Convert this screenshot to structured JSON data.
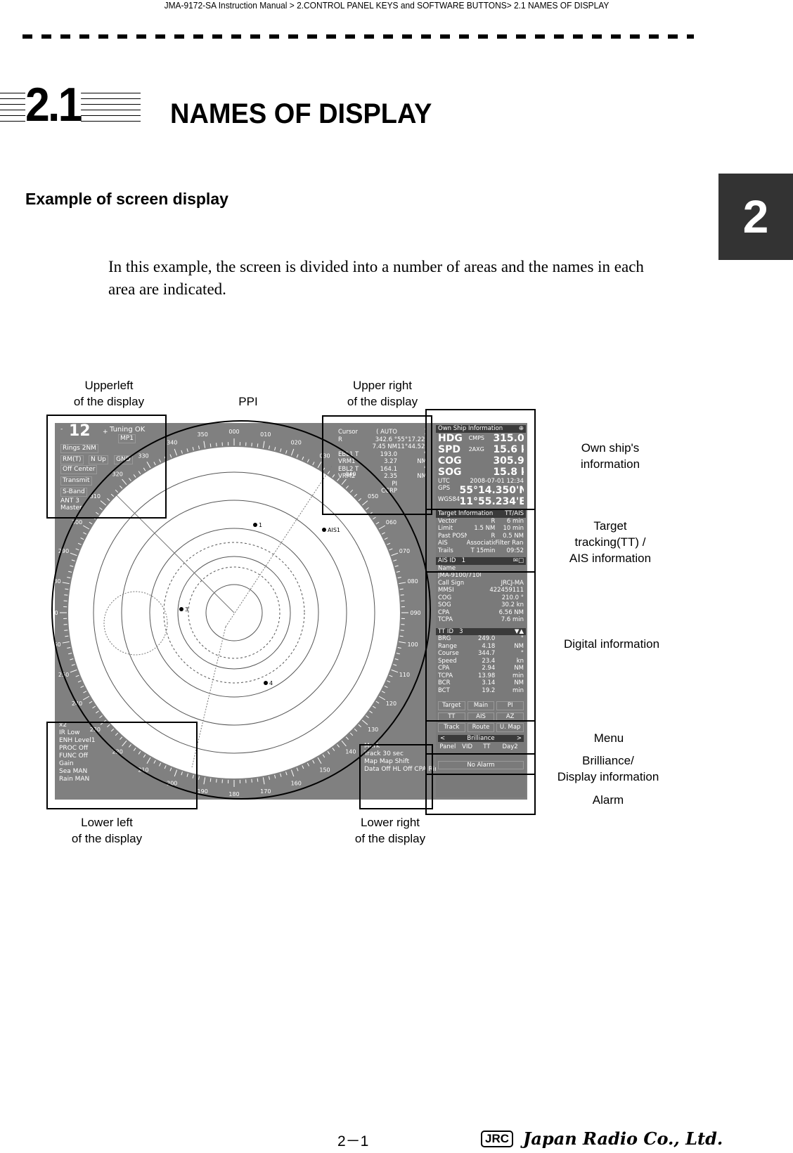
{
  "header": {
    "breadcrumb": "JMA-9172-SA Instruction Manual > 2.CONTROL PANEL KEYS and SOFTWARE BUTTONS> 2.1  NAMES OF DISPLAY"
  },
  "section": {
    "number": "2.1",
    "title": "NAMES OF DISPLAY",
    "chapter_tab": "2"
  },
  "subtitle": "Example of screen display",
  "paragraph": "In this example, the screen is divided into a number of areas and the names in each area are indicated.",
  "labels": {
    "upper_left": [
      "Upperleft",
      "of the display"
    ],
    "ppi": "PPI",
    "upper_right": [
      "Upper right",
      "of the display"
    ],
    "own_ship": [
      "Own ship's",
      "information"
    ],
    "target": [
      "Target",
      "tracking(TT) /",
      "AIS information"
    ],
    "digital": "Digital information",
    "menu": "Menu",
    "brilliance": [
      "Brilliance/",
      "Display  information"
    ],
    "alarm": "Alarm",
    "lower_left": [
      "Lower left",
      "of the display"
    ],
    "lower_right": [
      "Lower right",
      "of the display"
    ]
  },
  "radar": {
    "bearings": [
      "000",
      "010",
      "020",
      "030",
      "040",
      "050",
      "060",
      "070",
      "080",
      "090",
      "100",
      "110",
      "120",
      "130",
      "140",
      "150",
      "160",
      "170",
      "180",
      "190",
      "200",
      "210",
      "220",
      "230",
      "240",
      "250",
      "260",
      "270",
      "280",
      "290",
      "300",
      "310",
      "320",
      "330",
      "340",
      "350"
    ],
    "targets": [
      "1",
      "3",
      "4",
      "AIS1"
    ],
    "upper_left": {
      "minus": "-",
      "range": "12",
      "plus": "+",
      "tuning": "Tuning OK",
      "pulse": "MP1",
      "rings": "Rings  2NM",
      "motion": "RM(T)",
      "orient": "N  Up",
      "stab": "GND",
      "center": "Off  Center",
      "tx": "Transmit",
      "band": "S-Band",
      "ant": "ANT  3",
      "master": "Master"
    },
    "upper_right": {
      "rows": [
        [
          "Cursor",
          "(  AUTO",
          ")"
        ],
        [
          "R",
          "342.6 °",
          "55°17.229'N"
        ],
        [
          "",
          "7.45 NM",
          "11°44.529'E"
        ],
        [
          "EBL1 T",
          "193.0",
          "°"
        ],
        [
          "VRM1",
          "3.27",
          "NM"
        ],
        [
          "EBL2 T",
          "164.1",
          "°"
        ],
        [
          "VRM2",
          "2.35",
          "NM"
        ],
        [
          "",
          "PI",
          ""
        ],
        [
          "",
          "CCRP",
          ""
        ]
      ]
    },
    "own_ship": {
      "title": "Own  Ship  Information",
      "rows": [
        [
          "HDG",
          "CMPS",
          "315.0 °"
        ],
        [
          "SPD",
          "2AXG",
          "15.6 kn"
        ],
        [
          "COG",
          "",
          "305.9 °"
        ],
        [
          "SOG",
          "",
          "15.8 kn"
        ]
      ],
      "utc_label": "UTC",
      "utc": "2008-07-01  12:34",
      "gps": "GPS",
      "lat": "55°14.350'N",
      "datum": "WGS84",
      "lon": "11°55.234'E"
    },
    "target_info": {
      "title": "Target  Information",
      "mode": "TT/AIS",
      "rows": [
        [
          "Vector",
          "R",
          "6 min"
        ],
        [
          "Limit",
          "1.5 NM",
          "10 min"
        ],
        [
          "Past  POSN",
          "R",
          "0.5  NM"
        ],
        [
          "AIS",
          "Association",
          "Filter  Range"
        ],
        [
          "Trails",
          "T  15min",
          "09:52"
        ]
      ]
    },
    "ais": {
      "title": "AIS  ID",
      "id": "1",
      "rows": [
        [
          "Name",
          ""
        ],
        [
          "JMA-9100/7100  SERIES",
          ""
        ],
        [
          "Call  Sign",
          "JRCJ-MA"
        ],
        [
          "MMSI",
          "422459111"
        ],
        [
          "COG",
          "210.0 °"
        ],
        [
          "SOG",
          "30.2  kn"
        ],
        [
          "CPA",
          "6.56 NM"
        ],
        [
          "TCPA",
          "7.6  min"
        ]
      ]
    },
    "tt": {
      "title": "TT  ID",
      "id": "3",
      "rows": [
        [
          "BRG",
          "249.0",
          "°"
        ],
        [
          "Range",
          "4.18",
          "NM"
        ],
        [
          "Course",
          "344.7",
          "°"
        ],
        [
          "Speed",
          "23.4",
          "kn"
        ],
        [
          "CPA",
          "2.94",
          "NM"
        ],
        [
          "TCPA",
          "13.98",
          "min"
        ],
        [
          "BCR",
          "3.14",
          "NM"
        ],
        [
          "BCT",
          "19.2",
          "min"
        ]
      ]
    },
    "menu": [
      "Target",
      "Main",
      "PI",
      "TT",
      "AIS",
      "AZ",
      "Track",
      "Route",
      "U. Map"
    ],
    "brilliance": {
      "title": "Brilliance",
      "prev": "<",
      "next": ">",
      "items": [
        "Panel",
        "VID",
        "TT",
        "Day2"
      ]
    },
    "alarm": "No  Alarm",
    "lower_left": [
      "x2",
      "IR  Low",
      "ENH  Level1",
      "PROC  Off",
      "FUNC  Off",
      "Gain",
      "Sea   MAN",
      "Rain  MAN"
    ],
    "lower_right": [
      "Mark",
      "Track   30  sec",
      "Map  Map  Shift",
      "Data Off   HL Off   CPA Ring"
    ]
  },
  "footer": {
    "page": "2－1",
    "logo_mark": "JRC",
    "company": "Japan Radio Co., Ltd."
  }
}
